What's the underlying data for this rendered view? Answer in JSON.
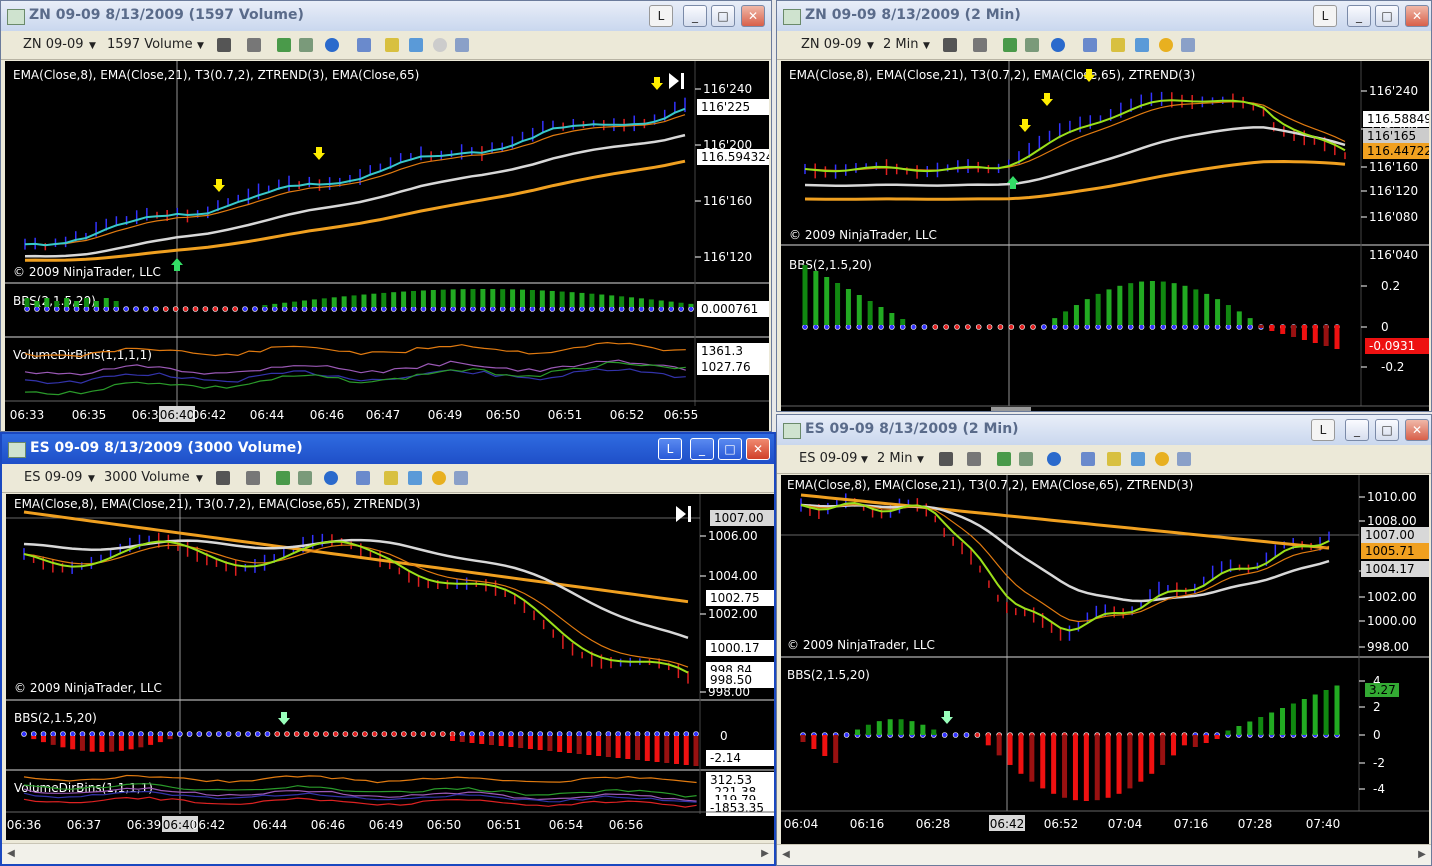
{
  "windows": {
    "zn_volume": {
      "title": "ZN 09-09  8/13/2009 (1597 Volume)",
      "instrument": "ZN 09-09",
      "period": "1597 Volume",
      "indicators_label": "EMA(Close,8),  EMA(Close,21),  T3(0.7,2),  ZTREND(3),  EMA(Close,65)",
      "copyright": "© 2009 NinjaTrader, LLC",
      "bbs_label": "BBS(2,1.5,20)",
      "vol_label": "VolumeDirBins(1,1,1,1)",
      "price_ticks": [
        "116'240",
        "116'200",
        "116'160",
        "116'120"
      ],
      "price_tags": [
        "116'225",
        "116.594324"
      ],
      "bbs_tag": "0.000761",
      "vol_tags": [
        "1361.3",
        "1027.76"
      ],
      "time_labels": [
        "06:33",
        "06:35",
        "06:39",
        "06:40",
        "06:42",
        "06:44",
        "06:46",
        "06:47",
        "06:49",
        "06:50",
        "06:51",
        "06:52",
        "06:55"
      ],
      "cursor_time": "06:40"
    },
    "zn_2min": {
      "title": "ZN 09-09  8/13/2009 (2 Min)",
      "instrument": "ZN 09-09",
      "period": "2 Min",
      "indicators_label": "EMA(Close,8),  EMA(Close,21),  T3(0.7,2),  EMA(Close,65),  ZTREND(3)",
      "copyright": "© 2009 NinjaTrader, LLC",
      "bbs_label": "BBS(2,1.5,20)",
      "price_ticks": [
        "116'240",
        "116'200",
        "116'160",
        "116'120",
        "116'080",
        "116'040"
      ],
      "price_tags": [
        "116.588495",
        "116'165",
        "116.447227"
      ],
      "bbs_ticks": [
        "0.2",
        "0",
        "-0.2"
      ],
      "bbs_tag": "-0.0931"
    },
    "es_volume": {
      "title": "ES 09-09  8/13/2009 (3000 Volume)",
      "instrument": "ES 09-09",
      "period": "3000 Volume",
      "indicators_label": "EMA(Close,8),  EMA(Close,21),  T3(0.7,2),  EMA(Close,65),  ZTREND(3)",
      "copyright": "© 2009 NinjaTrader, LLC",
      "bbs_label": "BBS(2,1.5,20)",
      "vol_label": "VolumeDirBins(1,1,1,1)",
      "price_ticks": [
        "1006.00",
        "1004.00",
        "1002.00",
        "998.00"
      ],
      "price_tags": [
        "1007.00",
        "1002.75",
        "1000.17",
        "998.84",
        "998.50"
      ],
      "bbs_ticks": [
        "0"
      ],
      "bbs_tag": "-2.14",
      "vol_tags": [
        "312.53",
        "-221.38",
        "-119.79",
        "-1853.35"
      ],
      "time_labels": [
        "06:36",
        "06:37",
        "06:39",
        "06:40",
        "06:42",
        "06:44",
        "06:46",
        "06:49",
        "06:50",
        "06:51",
        "06:54",
        "06:56"
      ],
      "cursor_time": "06:40"
    },
    "es_2min": {
      "title": "ES 09-09  8/13/2009 (2 Min)",
      "instrument": "ES 09-09",
      "period": "2 Min",
      "indicators_label": "EMA(Close,8),  EMA(Close,21),  T3(0.7,2),  EMA(Close,65),  ZTREND(3)",
      "copyright": "© 2009 NinjaTrader, LLC",
      "bbs_label": "BBS(2,1.5,20)",
      "price_ticks": [
        "1010.00",
        "1008.00",
        "1004.00",
        "1002.00",
        "1000.00",
        "998.00"
      ],
      "price_tags": [
        "1007.00",
        "1005.71",
        "1004.17"
      ],
      "bbs_ticks": [
        "4",
        "2",
        "0",
        "-2",
        "-4"
      ],
      "bbs_tag": "3.27",
      "time_labels": [
        "06:04",
        "06:16",
        "06:28",
        "06:42",
        "06:52",
        "07:04",
        "07:16",
        "07:28",
        "07:40"
      ],
      "cursor_time": "06:42"
    }
  },
  "window_buttons": {
    "link": "L",
    "minimize": "_",
    "maximize": "□",
    "close": "✕"
  },
  "colors": {
    "bg": "#000000",
    "ema8": "#39c9c9",
    "t3": "#9be01a",
    "ema21": "#e07a10",
    "ema65": "#f0a020",
    "white_ma": "#d8d8d8",
    "up_bar": "#3333ff",
    "down_bar": "#e02020",
    "bbs_pos": "#22aa22",
    "bbs_neg": "#ee1111",
    "arrow": "#ffee00"
  }
}
